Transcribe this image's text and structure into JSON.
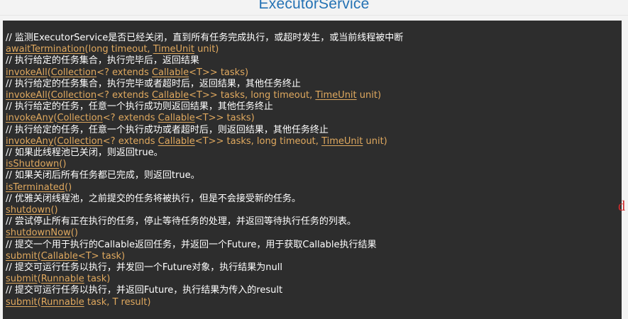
{
  "header": {
    "title": "ExecutorService"
  },
  "side_mark": "d",
  "lines": [
    {
      "c": "// 监测ExecutorService是否已经关闭，直到所有任务完成执行，或超时发生，或当前线程被中断"
    },
    {
      "m": "awaitTermination",
      "p1": "(long timeout, ",
      "t1": "TimeUnit",
      "p2": " unit)"
    },
    {
      "c": "// 执行给定的任务集合，执行完毕后，返回结果"
    },
    {
      "m": "invokeAll",
      "p0": "(",
      "t0": "Collection",
      "p1": "<? extends ",
      "t1": "Callable",
      "p2": "<T>> tasks)"
    },
    {
      "c": "// 执行给定的任务集合，执行完毕或者超时后，返回结果，其他任务终止"
    },
    {
      "m": "invokeAll",
      "p0": "(",
      "t0": "Collection",
      "p1": "<? extends ",
      "t1": "Callable",
      "p2": "<T>> tasks, long timeout, ",
      "t2": "TimeUnit",
      "p3": " unit)"
    },
    {
      "c": "// 执行给定的任务，任意一个执行成功则返回结果，其他任务终止"
    },
    {
      "m": "invokeAny",
      "p0": "(",
      "t0": "Collection",
      "p1": "<? extends ",
      "t1": "Callable",
      "p2": "<T>> tasks)"
    },
    {
      "c": "// 执行给定的任务，任意一个执行成功或者超时后，则返回结果，其他任务终止"
    },
    {
      "m": "invokeAny",
      "p0": "(",
      "t0": "Collection",
      "p1": "<? extends ",
      "t1": "Callable",
      "p2": "<T>> tasks, long timeout, ",
      "t2": "TimeUnit",
      "p3": " unit)"
    },
    {
      "c": "// 如果此线程池已关闭，则返回true。"
    },
    {
      "m": "isShutdown",
      "p0": "()"
    },
    {
      "c": "// 如果关闭后所有任务都已完成，则返回true。"
    },
    {
      "m": "isTerminated",
      "p0": "()"
    },
    {
      "c": "// 优雅关闭线程池，之前提交的任务将被执行，但是不会接受新的任务。"
    },
    {
      "m": "shutdown",
      "p0": "()"
    },
    {
      "c": "// 尝试停止所有正在执行的任务，停止等待任务的处理，并返回等待执行任务的列表。"
    },
    {
      "m": "shutdownNow",
      "p0": "()"
    },
    {
      "c": "// 提交一个用于执行的Callable返回任务，并返回一个Future，用于获取Callable执行结果"
    },
    {
      "m": "submit",
      "p0": "(",
      "t0": "Callable",
      "p1": "<T> task)"
    },
    {
      "c": "// 提交可运行任务以执行，并发回一个Future对象，执行结果为null"
    },
    {
      "m": "submit",
      "p0": "(",
      "t0": "Runnable",
      "p1": " task)"
    },
    {
      "c": "// 提交可运行任务以执行，并返回Future，执行结果为传入的result"
    },
    {
      "m": "submit",
      "p0": "(",
      "t0": "Runnable",
      "p1": " task, T result)"
    }
  ]
}
